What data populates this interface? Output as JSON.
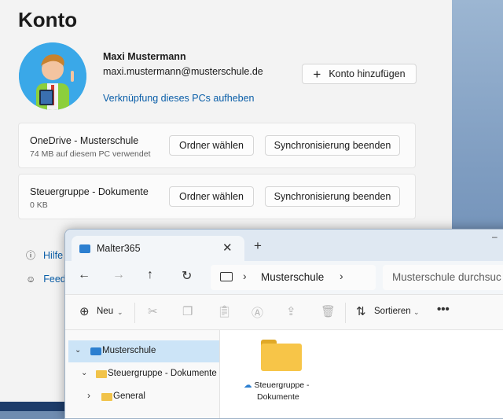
{
  "settings": {
    "title": "Konto",
    "user_name": "Maxi Mustermann",
    "user_email": "maxi.mustermann@musterschule.de",
    "unlink_label": "Verknüpfung dieses PCs aufheben",
    "add_account_label": "Konto hinzufügen",
    "accounts": [
      {
        "name": "OneDrive - Musterschule",
        "detail": "74 MB auf diesem PC verwendet",
        "choose_folder": "Ordner wählen",
        "stop_sync": "Synchronisierung beenden"
      },
      {
        "name": "Steuergruppe - Dokumente",
        "detail": "0 KB",
        "choose_folder": "Ordner wählen",
        "stop_sync": "Synchronisierung beenden"
      }
    ],
    "help_label": "Hilfe",
    "feedback_label": "Feed"
  },
  "explorer": {
    "tab_title": "Malter365",
    "breadcrumb": "Musterschule",
    "search_placeholder": "Musterschule durchsuc",
    "toolbar": {
      "new_label": "Neu",
      "sort_label": "Sortieren"
    },
    "tree": [
      {
        "label": "Musterschule",
        "selected": true
      },
      {
        "label": "Steuergruppe - Dokumente",
        "selected": false
      },
      {
        "label": "General",
        "selected": false
      }
    ],
    "item": {
      "name_line1": "Steuergruppe -",
      "name_line2": "Dokumente"
    }
  }
}
